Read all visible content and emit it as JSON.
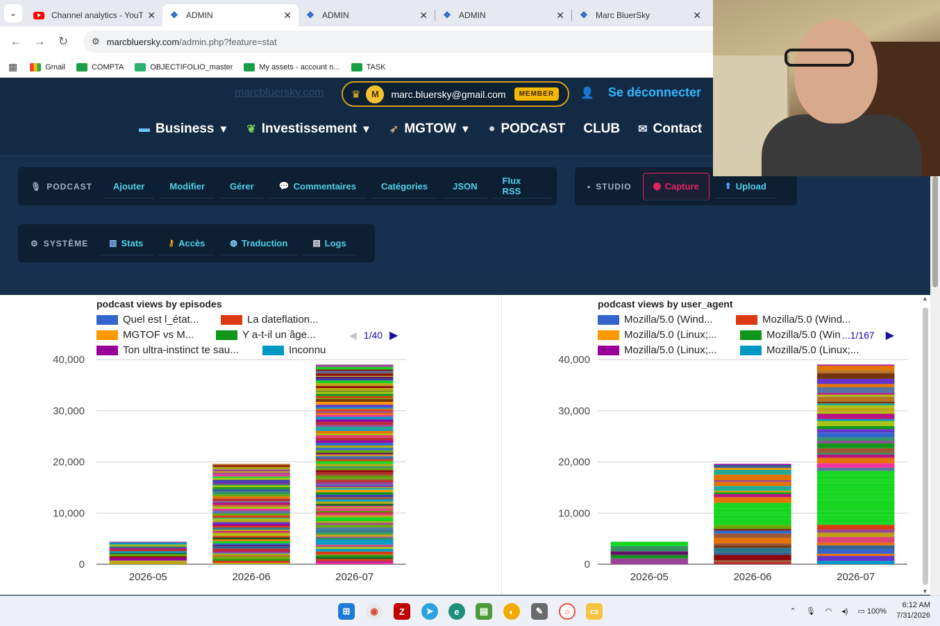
{
  "browser": {
    "tabs": [
      {
        "title": "Channel analytics - YouTub",
        "favicon": "youtube-icon",
        "active": false
      },
      {
        "title": "ADMIN",
        "favicon": "admin-icon",
        "active": true
      },
      {
        "title": "ADMIN",
        "favicon": "admin-icon",
        "active": false
      },
      {
        "title": "ADMIN",
        "favicon": "admin-icon",
        "active": false
      },
      {
        "title": "Marc BluerSky",
        "favicon": "admin-icon",
        "active": false
      }
    ],
    "url_host": "marcbluersky.com",
    "url_path": "/admin.php?feature=stat",
    "bookmarks": [
      "Gmail",
      "COMPTA",
      "OBJECTIFOLIO_master",
      "My assets - account n...",
      "TASK"
    ]
  },
  "site": {
    "brand": "marcbluersky.com",
    "user_initial": "M",
    "email": "marc.bluersky@gmail.com",
    "badge": "MEMBER",
    "logout": "Se déconnecter",
    "nav": [
      {
        "label": "Business",
        "caret": "▼"
      },
      {
        "label": "Investissement",
        "caret": "▼"
      },
      {
        "label": "MGTOW",
        "caret": "▼"
      },
      {
        "label": "PODCAST",
        "caret": ""
      },
      {
        "label": "CLUB",
        "caret": ""
      },
      {
        "label": "Contact",
        "caret": ""
      }
    ]
  },
  "admin": {
    "podcast_header": "PODCAST",
    "podcast_links": [
      "Ajouter",
      "Modifier",
      "Gérer",
      "Commentaires",
      "Catégories",
      "JSON",
      "Flux RSS"
    ],
    "studio_header": "STUDIO",
    "studio_links": [
      "Capture",
      "Upload"
    ],
    "system_header": "SYSTÈME",
    "system_links": [
      "Stats",
      "Accès",
      "Traduction",
      "Logs"
    ]
  },
  "chart_data": [
    {
      "type": "bar",
      "stacked": true,
      "title": "podcast views by episodes",
      "categories": [
        "2026-05",
        "2026-06",
        "2026-07"
      ],
      "totals": [
        4400,
        19600,
        39000
      ],
      "ylim": [
        0,
        40000
      ],
      "yticks": [
        "0",
        "10,000",
        "20,000",
        "30,000",
        "40,000"
      ],
      "legend": [
        {
          "name": "Quel est l_état...",
          "color": "#3366cc"
        },
        {
          "name": "La dateflation...",
          "color": "#dc3912"
        },
        {
          "name": "MGTOF vs M...",
          "color": "#ff9900"
        },
        {
          "name": "Y a-t-il un âge...",
          "color": "#109618"
        },
        {
          "name": "Ton ultra-instinct te sau...",
          "color": "#990099"
        },
        {
          "name": "Inconnu",
          "color": "#0099c6"
        }
      ],
      "pager": "1/40"
    },
    {
      "type": "bar",
      "stacked": true,
      "title": "podcast views by user_agent",
      "categories": [
        "2026-05",
        "2026-06",
        "2026-07"
      ],
      "totals": [
        4400,
        19600,
        39000
      ],
      "ylim": [
        0,
        40000
      ],
      "yticks": [
        "0",
        "10,000",
        "20,000",
        "30,000",
        "40,000"
      ],
      "legend": [
        {
          "name": "Mozilla/5.0 (Wind...",
          "color": "#3366cc"
        },
        {
          "name": "Mozilla/5.0 (Wind...",
          "color": "#dc3912"
        },
        {
          "name": "Mozilla/5.0 (Linux;...",
          "color": "#ff9900"
        },
        {
          "name": "Mozilla/5.0 (Win",
          "color": "#109618"
        },
        {
          "name": "Mozilla/5.0 (Linux;...",
          "color": "#990099"
        },
        {
          "name": "Mozilla/5.0 (Linux;...",
          "color": "#0099c6"
        }
      ],
      "pager": "...1/167"
    }
  ],
  "taskbar": {
    "battery": "100%",
    "time": "6:12 AM",
    "date": "7/31/2026"
  }
}
